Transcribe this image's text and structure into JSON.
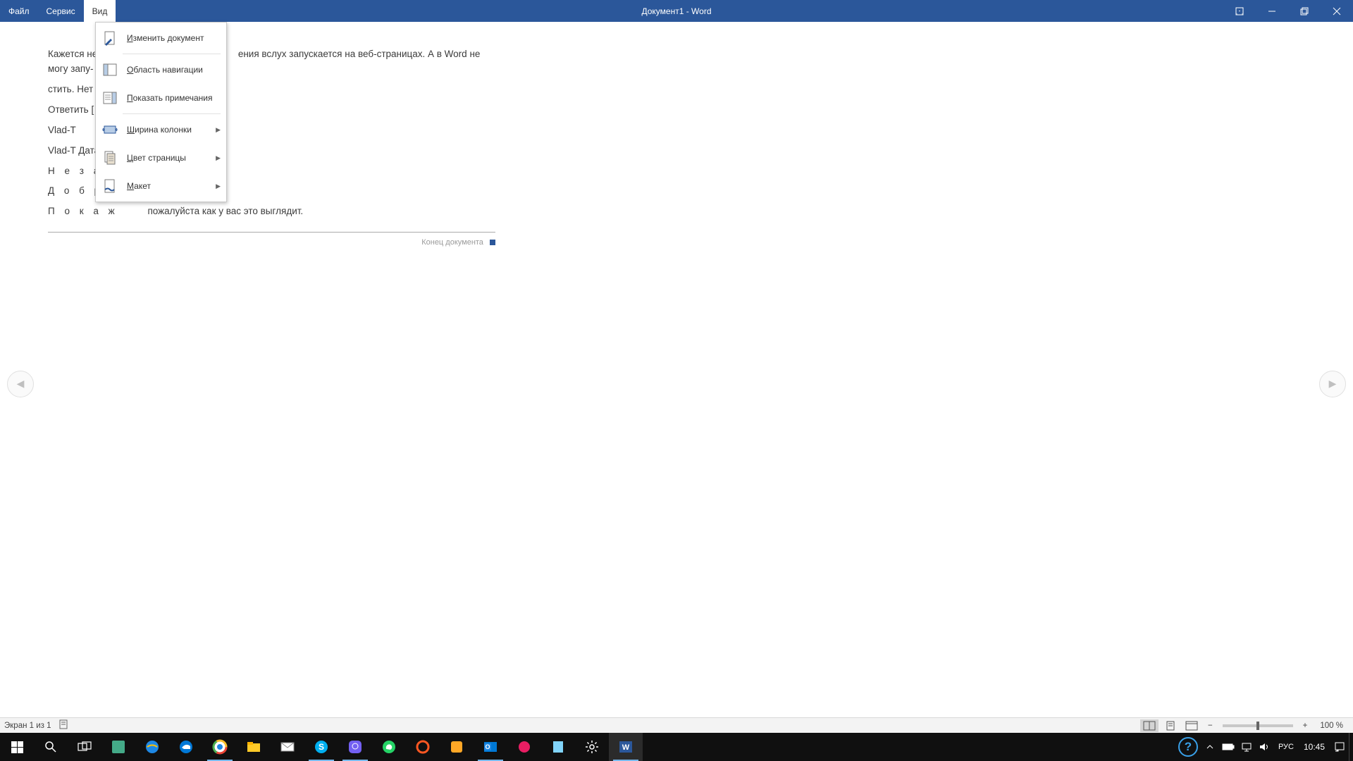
{
  "titlebar": {
    "menus": {
      "file": "Файл",
      "tools": "Сервис",
      "view": "Вид"
    },
    "title": "Документ1  -  Word"
  },
  "dropdown": {
    "edit_document": "Изменить документ",
    "nav_pane": "Область навигации",
    "show_comments": "Показать примечания",
    "column_width": "Ширина колонки",
    "page_color": "Цвет страницы",
    "layout": "Макет"
  },
  "document": {
    "p1_a": "Кажется не",
    "p1_b": "ения вслух запускается на веб-страницах. А в Word не могу запу-",
    "p2_a": "стить. Нет в",
    "p3": "Ответить   [",
    "p4": "Vlad-T",
    "p5": "Vlad-T Дата",
    "p6": "Н е з а в",
    "p7": "Д о б р ы",
    "p8_a": "П о к а ж",
    "p8_b": "пожалуйста как у вас это выглядит.",
    "end": "Конец документа"
  },
  "statusbar": {
    "page": "Экран 1 из 1",
    "zoom": "100 %"
  },
  "taskbar": {
    "lang": "РУС",
    "time": "10:45"
  }
}
